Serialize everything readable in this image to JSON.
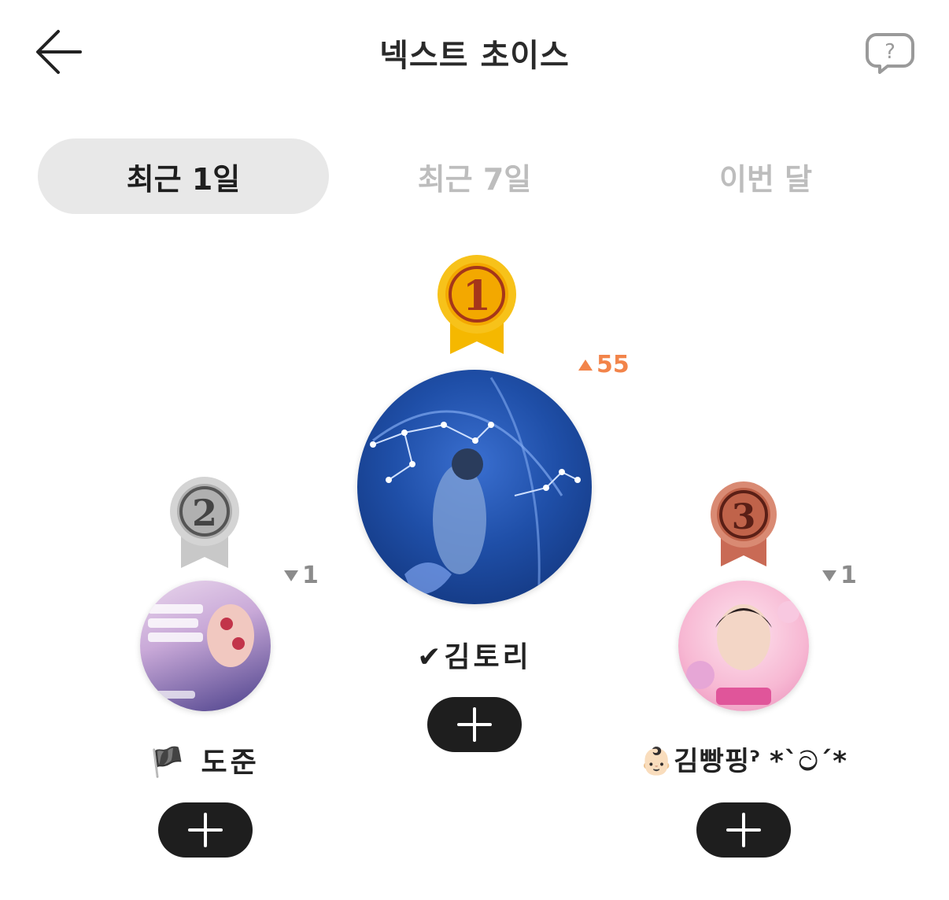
{
  "header": {
    "title": "넥스트 초이스",
    "back_icon": "arrow-left-icon",
    "help_icon": "question-bubble-icon"
  },
  "tabs": [
    {
      "label": "최근 1일",
      "active": true
    },
    {
      "label": "최근 7일",
      "active": false
    },
    {
      "label": "이번 달",
      "active": false
    }
  ],
  "ranking": [
    {
      "rank": "1",
      "name": "✔김토리",
      "change": "55",
      "direction": "up",
      "medal_color": "#f2b705"
    },
    {
      "rank": "2",
      "name": "🏴 도준",
      "change": "1",
      "direction": "down",
      "medal_color": "#b8b8b8"
    },
    {
      "rank": "3",
      "name": "👶🏻김빵핑ˀ *`ට´*",
      "change": "1",
      "direction": "down",
      "medal_color": "#c96a55"
    }
  ],
  "colors": {
    "up": "#f2844a",
    "down": "#8b8b8b",
    "add_button": "#1e1e1e"
  }
}
